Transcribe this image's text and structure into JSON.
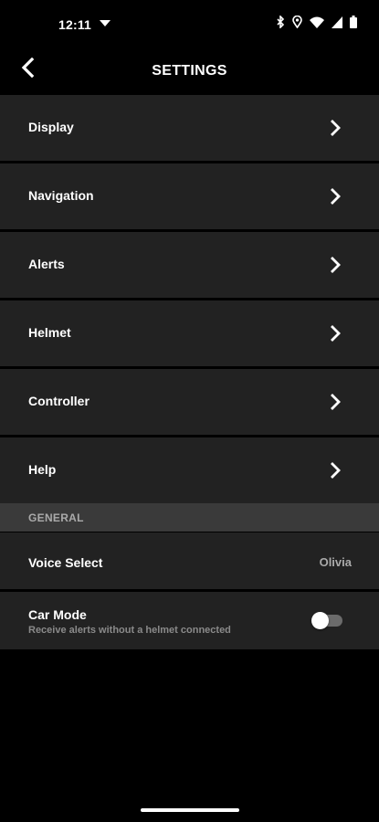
{
  "status_bar": {
    "time": "12:11",
    "icons": [
      "dropdown-triangle-icon",
      "bluetooth-icon",
      "location-pin-icon",
      "wifi-icon",
      "signal-icon",
      "battery-icon"
    ]
  },
  "header": {
    "title": "SETTINGS",
    "back_icon": "back-chevron-icon"
  },
  "menu_items": [
    {
      "label": "Display"
    },
    {
      "label": "Navigation"
    },
    {
      "label": "Alerts"
    },
    {
      "label": "Helmet"
    },
    {
      "label": "Controller"
    },
    {
      "label": "Help"
    }
  ],
  "general_section": {
    "title": "GENERAL",
    "voice_select": {
      "label": "Voice Select",
      "value": "Olivia"
    },
    "car_mode": {
      "label": "Car Mode",
      "description": "Receive alerts without a helmet connected",
      "enabled": false
    }
  },
  "colors": {
    "background": "#000000",
    "row_background": "#222222",
    "section_header_bg": "#3a3a3a",
    "secondary_text": "#aaaaaa"
  }
}
